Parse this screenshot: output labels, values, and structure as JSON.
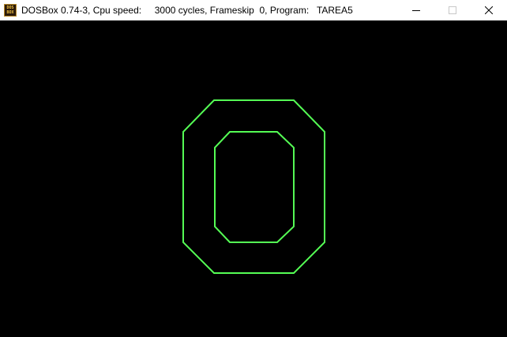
{
  "window": {
    "title": "DOSBox 0.74-3, Cpu speed:     3000 cycles, Frameskip  0, Program:   TAREA5",
    "icon": "dosbox-icon",
    "icon_text_top": "DOS",
    "icon_text_bottom": "BOX"
  },
  "caption_buttons": {
    "minimize_icon": "minimize-icon",
    "maximize_icon": "maximize-icon",
    "close_icon": "close-icon"
  },
  "screen": {
    "background": "#000000",
    "line_color": "#55ff55",
    "shapes": [
      "outer-octagon",
      "inner-octagon"
    ]
  }
}
